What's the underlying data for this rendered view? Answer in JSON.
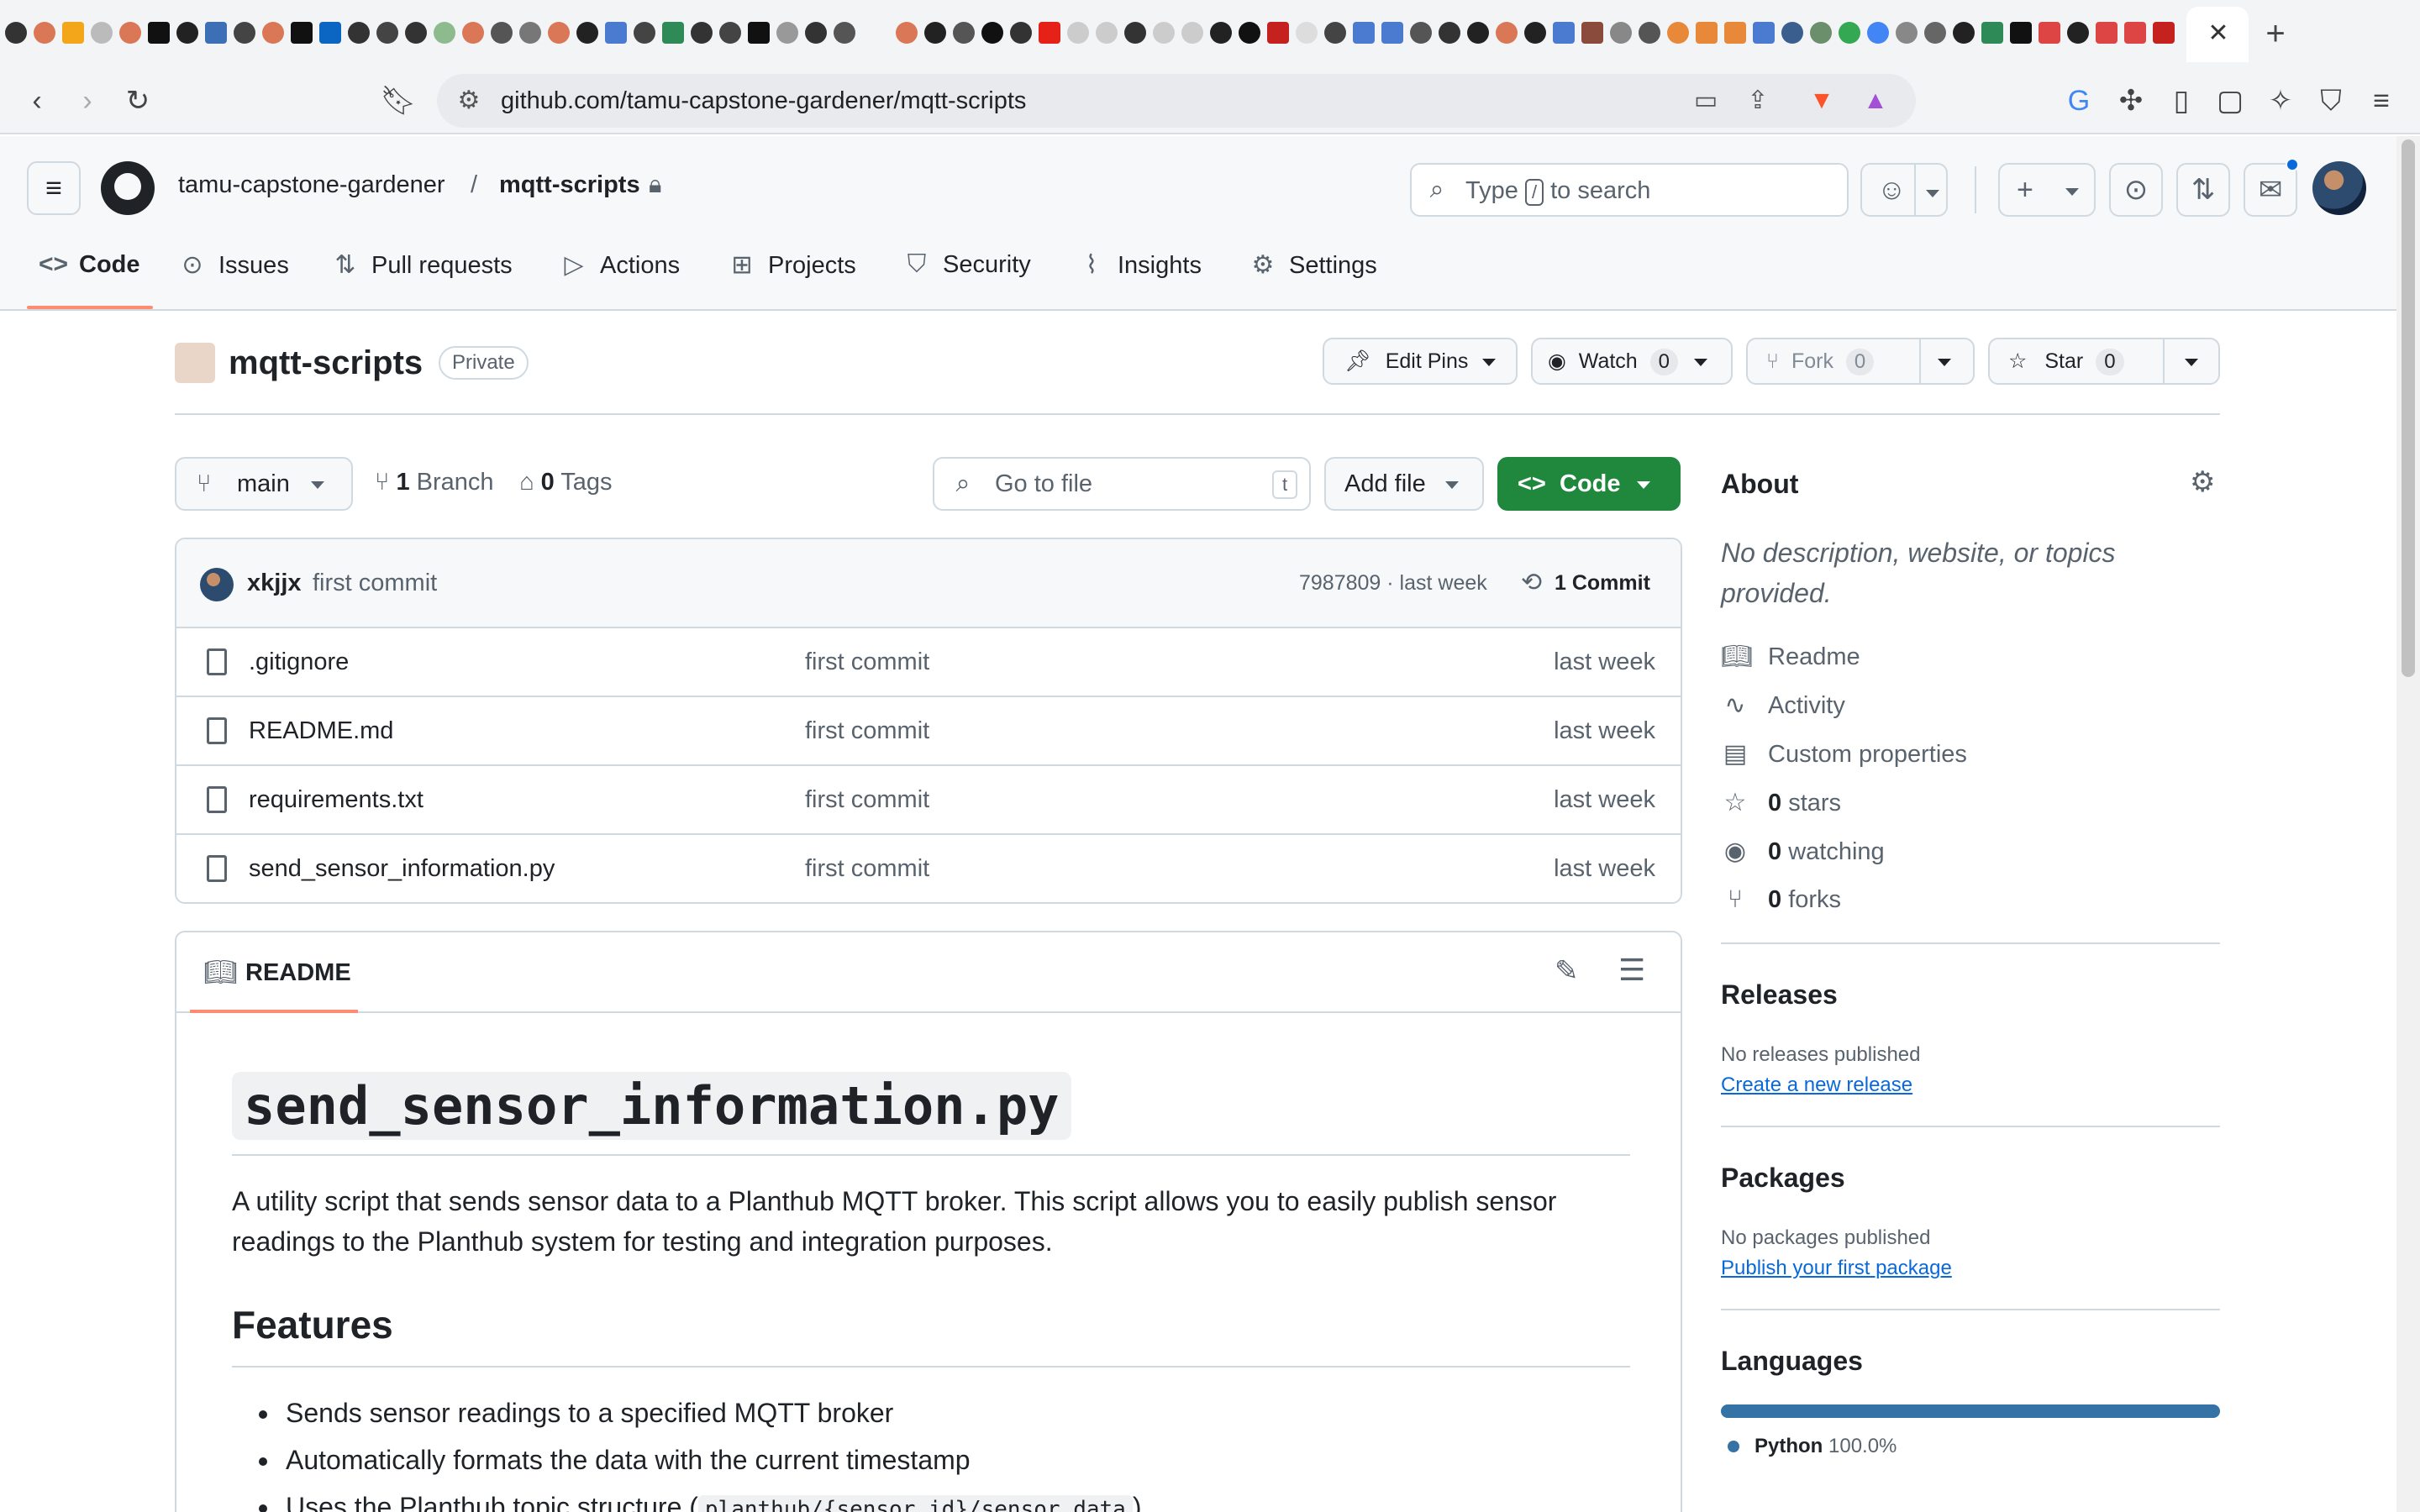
{
  "browser": {
    "url": "github.com/tamu-capstone-gardener/mqtt-scripts",
    "tab_close": "✕",
    "new_tab": "+"
  },
  "header": {
    "owner": "tamu-capstone-gardener",
    "separator": "/",
    "repo": "mqtt-scripts",
    "search_prefix": "Type",
    "search_key": "/",
    "search_suffix": "to search"
  },
  "nav_tabs": [
    {
      "label": "Code",
      "icon": "code-icon"
    },
    {
      "label": "Issues",
      "icon": "issue-icon"
    },
    {
      "label": "Pull requests",
      "icon": "pull-request-icon"
    },
    {
      "label": "Actions",
      "icon": "play-icon"
    },
    {
      "label": "Projects",
      "icon": "table-icon"
    },
    {
      "label": "Security",
      "icon": "shield-icon"
    },
    {
      "label": "Insights",
      "icon": "graph-icon"
    },
    {
      "label": "Settings",
      "icon": "gear-icon"
    }
  ],
  "repo_title": {
    "name": "mqtt-scripts",
    "visibility": "Private",
    "edit_pins": "Edit Pins",
    "watch": "Watch",
    "watch_count": "0",
    "fork": "Fork",
    "fork_count": "0",
    "star": "Star",
    "star_count": "0"
  },
  "branch_bar": {
    "branch": "main",
    "branch_count": "1",
    "branch_label": "Branch",
    "tag_count": "0",
    "tag_label": "Tags",
    "goto_placeholder": "Go to file",
    "goto_key": "t",
    "add_file": "Add file",
    "code": "Code"
  },
  "latest_commit": {
    "author": "xkjjx",
    "message": "first commit",
    "hash_time": "7987809 · last week",
    "commits": "1 Commit"
  },
  "files": [
    {
      "name": ".gitignore",
      "message": "first commit",
      "date": "last week"
    },
    {
      "name": "README.md",
      "message": "first commit",
      "date": "last week"
    },
    {
      "name": "requirements.txt",
      "message": "first commit",
      "date": "last week"
    },
    {
      "name": "send_sensor_information.py",
      "message": "first commit",
      "date": "last week"
    }
  ],
  "readme": {
    "tab": "README",
    "title": "send_sensor_information.py",
    "intro": "A utility script that sends sensor data to a Planthub MQTT broker. This script allows you to easily publish sensor readings to the Planthub system for testing and integration purposes.",
    "features_heading": "Features",
    "features": [
      "Sends sensor readings to a specified MQTT broker",
      "Automatically formats the data with the current timestamp"
    ],
    "feature3_prefix": "Uses the Planthub topic structure (",
    "feature3_code": "planthub/{sensor_id}/sensor_data",
    "feature3_suffix": ")"
  },
  "about": {
    "heading": "About",
    "description": "No description, website, or topics provided.",
    "readme": "Readme",
    "activity": "Activity",
    "custom_properties": "Custom properties",
    "stars_count": "0",
    "stars_label": "stars",
    "watching_count": "0",
    "watching_label": "watching",
    "forks_count": "0",
    "forks_label": "forks"
  },
  "releases": {
    "heading": "Releases",
    "none": "No releases published",
    "link": "Create a new release"
  },
  "packages": {
    "heading": "Packages",
    "none": "No packages published",
    "link": "Publish your first package"
  },
  "languages": {
    "heading": "Languages",
    "name": "Python",
    "percent": "100.0%",
    "share": 1.0,
    "color": "#3572a5"
  },
  "colors": {
    "accent_green": "#1f883d",
    "tab_underline": "#fd8c73",
    "link_blue": "#0969da"
  }
}
